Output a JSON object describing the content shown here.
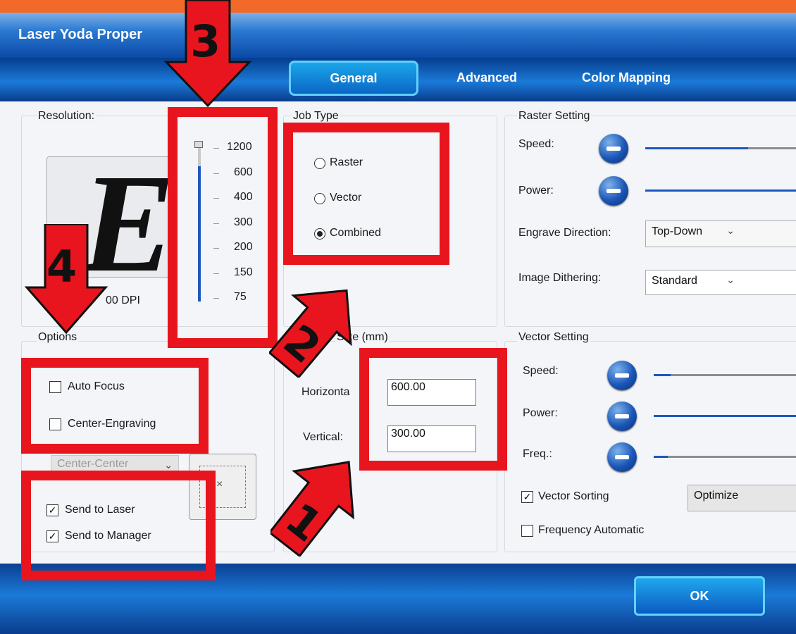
{
  "window": {
    "title": "Laser Yoda Proper"
  },
  "tabs": [
    {
      "label": "General"
    },
    {
      "label": "Advanced"
    },
    {
      "label": "Color Mapping"
    }
  ],
  "resolution": {
    "label": "Resolution:",
    "preview_letter": "E",
    "dpi_text": "00 DPI",
    "ticks": [
      "1200",
      "600",
      "400",
      "300",
      "200",
      "150",
      "75"
    ]
  },
  "job_type": {
    "label": "Job Type",
    "options": [
      "Raster",
      "Vector",
      "Combined"
    ],
    "selected": "Combined"
  },
  "size": {
    "label": "Size (mm)",
    "horizontal_label": "Horizonta",
    "horizontal_value": "600.00",
    "vertical_label": "Vertical:",
    "vertical_value": "300.00"
  },
  "options": {
    "label": "Options",
    "auto_focus": "Auto Focus",
    "center_engraving": "Center-Engraving",
    "anchor_select": "Center-Center",
    "send_to_laser": "Send to Laser",
    "send_to_manager": "Send to Manager"
  },
  "raster": {
    "label": "Raster Setting",
    "speed_label": "Speed:",
    "speed_level": 0.68,
    "power_label": "Power:",
    "power_level": 1.0,
    "engrave_direction_label": "Engrave Direction:",
    "engrave_direction_value": "Top-Down",
    "image_dithering_label": "Image Dithering:",
    "image_dithering_value": "Standard"
  },
  "vector": {
    "label": "Vector Setting",
    "speed_label": "Speed:",
    "speed_level": 0.12,
    "power_label": "Power:",
    "power_level": 1.0,
    "freq_label": "Freq.:",
    "freq_level": 0.1,
    "vector_sorting": "Vector Sorting",
    "sorting_value": "Optimize",
    "frequency_automatic": "Frequency Automatic"
  },
  "buttons": {
    "ok": "OK"
  },
  "annotations": {
    "n1": "1",
    "n2": "2",
    "n3": "3",
    "n4": "4"
  },
  "colors": {
    "annotation_red": "#e8151e",
    "accent_blue": "#1a6fd2",
    "title_orange": "#f26a2a"
  }
}
